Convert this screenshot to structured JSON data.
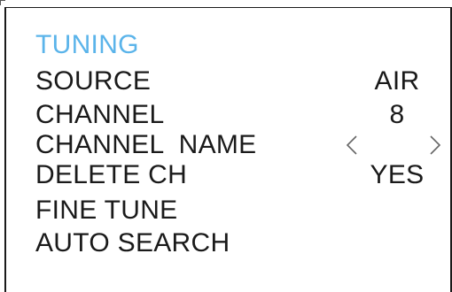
{
  "menu": {
    "title": "TUNING",
    "items": [
      {
        "label": "SOURCE",
        "value": "AIR"
      },
      {
        "label": "CHANNEL",
        "value": "8"
      },
      {
        "label": "CHANNEL  NAME",
        "value": ""
      },
      {
        "label": "DELETE CH",
        "value": "YES"
      },
      {
        "label": "FINE TUNE",
        "value": ""
      },
      {
        "label": "AUTO SEARCH",
        "value": ""
      }
    ],
    "name_arrows": {
      "left_icon": "chevron-left-icon",
      "right_icon": "chevron-right-icon"
    }
  },
  "colors": {
    "title": "#5bb4ea",
    "text": "#1a1a1a",
    "background": "#ffffff",
    "arrow": "#666666"
  }
}
